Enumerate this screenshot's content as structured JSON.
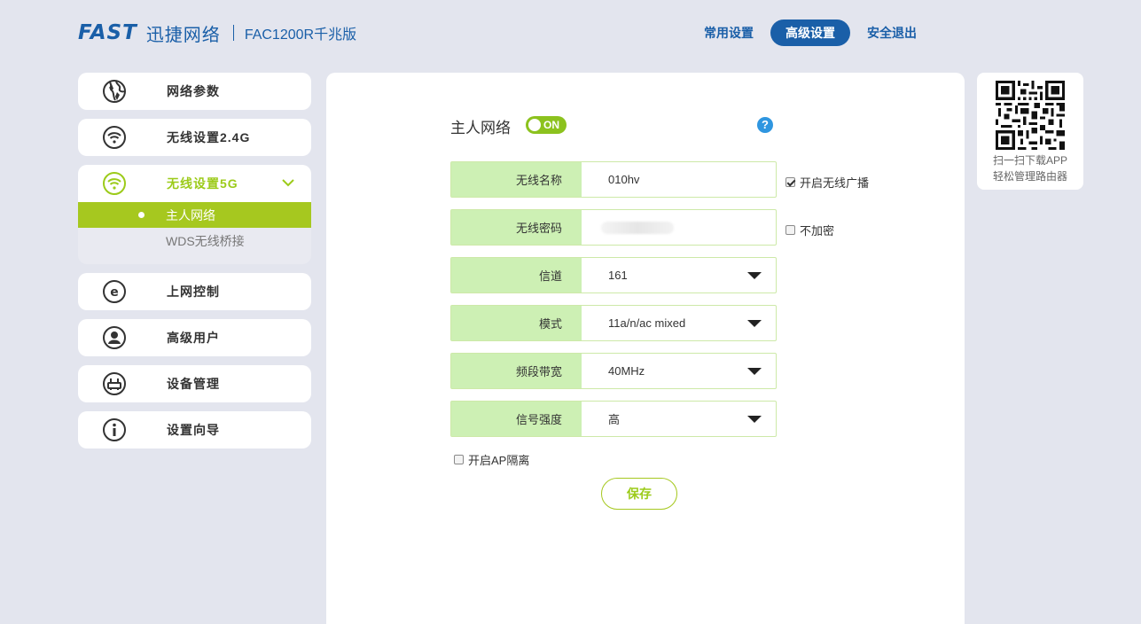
{
  "header": {
    "logo_brand": "FAST",
    "logo_cn": "迅捷网络",
    "model": "FAC1200R千兆版",
    "nav": [
      {
        "label": "常用设置",
        "active": false
      },
      {
        "label": "高级设置",
        "active": true
      },
      {
        "label": "安全退出",
        "active": false
      }
    ]
  },
  "sidebar": {
    "items": [
      {
        "label": "网络参数",
        "icon": "globe-icon"
      },
      {
        "label": "无线设置2.4G",
        "icon": "wifi-icon"
      },
      {
        "label": "无线设置5G",
        "icon": "wifi-icon"
      },
      {
        "label": "上网控制",
        "icon": "e-icon"
      },
      {
        "label": "高级用户",
        "icon": "user-icon"
      },
      {
        "label": "设备管理",
        "icon": "router-icon"
      },
      {
        "label": "设置向导",
        "icon": "info-icon"
      }
    ],
    "submenu": [
      {
        "label": "主人网络",
        "active": true
      },
      {
        "label": "WDS无线桥接",
        "active": false
      }
    ]
  },
  "main": {
    "section_title": "主人网络",
    "toggle_text": "ON",
    "help": "?",
    "fields": {
      "ssid": {
        "label": "无线名称",
        "value": "010hv"
      },
      "password": {
        "label": "无线密码",
        "value": ""
      },
      "channel": {
        "label": "信道",
        "value": "161"
      },
      "mode": {
        "label": "模式",
        "value": "11a/n/ac mixed"
      },
      "bandwidth": {
        "label": "频段带宽",
        "value": "40MHz"
      },
      "signal": {
        "label": "信号强度",
        "value": "高"
      }
    },
    "broadcast_label": "开启无线广播",
    "broadcast_checked": true,
    "no_encrypt_label": "不加密",
    "no_encrypt_checked": false,
    "ap_isolation_label": "开启AP隔离",
    "ap_isolation_checked": false,
    "save_label": "保存"
  },
  "qr": {
    "line1": "扫一扫下载APP",
    "line2": "轻松管理路由器"
  },
  "colors": {
    "brand_blue": "#1a5fa8",
    "accent_green": "#a6c81f",
    "label_bg": "#cdf0b4",
    "background": "#e3e5ee"
  }
}
